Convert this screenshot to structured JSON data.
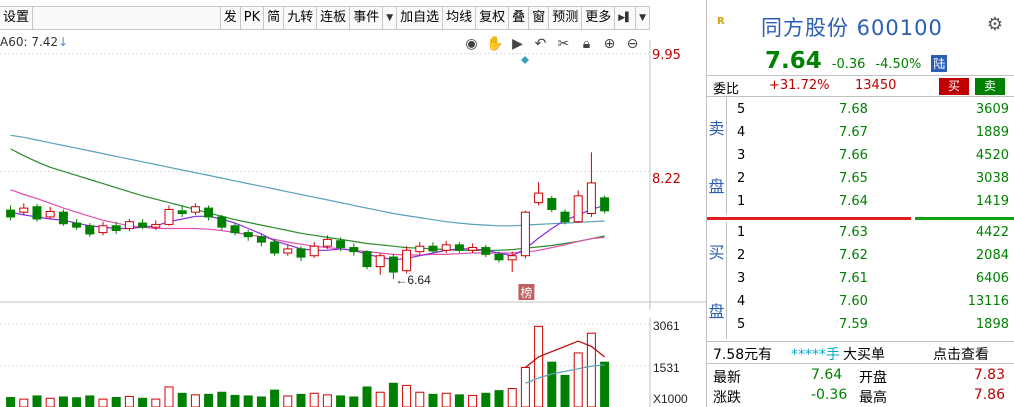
{
  "toolbar": {
    "settings": "设置",
    "items": [
      "发",
      "PK",
      "简",
      "九转",
      "连板",
      "事件",
      "加自选",
      "均线",
      "复权",
      "叠",
      "窗",
      "预测",
      "更多"
    ]
  },
  "ma_label": {
    "text": "A60: 7.42",
    "arrow": "↓"
  },
  "price_axis": {
    "high": "9.95",
    "mid": "8.22",
    "low_marker": "6.64"
  },
  "volume_axis": {
    "v1": "3061",
    "v2": "1531",
    "unit": "X1000"
  },
  "marker_tag": "榜",
  "stock": {
    "badge": "R",
    "title": "同方股份 600100",
    "price": "7.64",
    "change": "-0.36",
    "change_pct": "-4.50%",
    "board": "陆"
  },
  "weibi": {
    "label": "委比",
    "pct": "+31.72%",
    "diff": "13450",
    "buy": "买",
    "sell": "卖"
  },
  "sell_book": {
    "side_chars": [
      "卖",
      "盘"
    ],
    "rows": [
      {
        "level": "5",
        "price": "7.68",
        "volume": "3609"
      },
      {
        "level": "4",
        "price": "7.67",
        "volume": "1889"
      },
      {
        "level": "3",
        "price": "7.66",
        "volume": "4520"
      },
      {
        "level": "2",
        "price": "7.65",
        "volume": "3038"
      },
      {
        "level": "1",
        "price": "7.64",
        "volume": "1419"
      }
    ]
  },
  "buy_book": {
    "side_chars": [
      "买",
      "盘"
    ],
    "rows": [
      {
        "level": "1",
        "price": "7.63",
        "volume": "4422"
      },
      {
        "level": "2",
        "price": "7.62",
        "volume": "2084"
      },
      {
        "level": "3",
        "price": "7.61",
        "volume": "6406"
      },
      {
        "level": "4",
        "price": "7.60",
        "volume": "13116"
      },
      {
        "level": "5",
        "price": "7.59",
        "volume": "1898"
      }
    ]
  },
  "big_order": {
    "p1": "7.58元有",
    "p2": "*****手",
    "p3": "大买单",
    "p4": "点击查看"
  },
  "stats": [
    {
      "k1": "最新",
      "v1": "7.64",
      "k2": "开盘",
      "v2": "7.83"
    },
    {
      "k1": "涨跌",
      "v1": "-0.36",
      "k2": "最高",
      "v2": "7.86"
    }
  ],
  "colors": {
    "up": "#c00000",
    "down": "#008000",
    "accent": "#2b5fb3"
  },
  "chart_data": {
    "type": "candlestick",
    "price_ylim": [
      6.3,
      10.15
    ],
    "candles": [
      {
        "o": 7.65,
        "c": 7.55,
        "h": 7.72,
        "l": 7.5
      },
      {
        "o": 7.62,
        "c": 7.68,
        "h": 7.75,
        "l": 7.58
      },
      {
        "o": 7.7,
        "c": 7.52,
        "h": 7.74,
        "l": 7.48
      },
      {
        "o": 7.55,
        "c": 7.63,
        "h": 7.7,
        "l": 7.52
      },
      {
        "o": 7.62,
        "c": 7.45,
        "h": 7.66,
        "l": 7.42
      },
      {
        "o": 7.46,
        "c": 7.4,
        "h": 7.52,
        "l": 7.36
      },
      {
        "o": 7.42,
        "c": 7.3,
        "h": 7.46,
        "l": 7.26
      },
      {
        "o": 7.32,
        "c": 7.42,
        "h": 7.48,
        "l": 7.28
      },
      {
        "o": 7.42,
        "c": 7.35,
        "h": 7.48,
        "l": 7.3
      },
      {
        "o": 7.38,
        "c": 7.48,
        "h": 7.52,
        "l": 7.34
      },
      {
        "o": 7.46,
        "c": 7.4,
        "h": 7.52,
        "l": 7.37
      },
      {
        "o": 7.4,
        "c": 7.44,
        "h": 7.5,
        "l": 7.36
      },
      {
        "o": 7.44,
        "c": 7.66,
        "h": 7.72,
        "l": 7.42
      },
      {
        "o": 7.64,
        "c": 7.6,
        "h": 7.72,
        "l": 7.55
      },
      {
        "o": 7.62,
        "c": 7.7,
        "h": 7.75,
        "l": 7.58
      },
      {
        "o": 7.68,
        "c": 7.55,
        "h": 7.72,
        "l": 7.5
      },
      {
        "o": 7.55,
        "c": 7.4,
        "h": 7.58,
        "l": 7.36
      },
      {
        "o": 7.42,
        "c": 7.32,
        "h": 7.46,
        "l": 7.28
      },
      {
        "o": 7.32,
        "c": 7.26,
        "h": 7.36,
        "l": 7.2
      },
      {
        "o": 7.26,
        "c": 7.18,
        "h": 7.3,
        "l": 7.12
      },
      {
        "o": 7.18,
        "c": 7.02,
        "h": 7.22,
        "l": 6.98
      },
      {
        "o": 7.02,
        "c": 7.08,
        "h": 7.14,
        "l": 6.98
      },
      {
        "o": 7.08,
        "c": 6.96,
        "h": 7.12,
        "l": 6.9
      },
      {
        "o": 6.98,
        "c": 7.12,
        "h": 7.18,
        "l": 6.95
      },
      {
        "o": 7.12,
        "c": 7.22,
        "h": 7.28,
        "l": 7.08
      },
      {
        "o": 7.2,
        "c": 7.1,
        "h": 7.25,
        "l": 7.05
      },
      {
        "o": 7.1,
        "c": 7.04,
        "h": 7.16,
        "l": 6.98
      },
      {
        "o": 7.04,
        "c": 6.82,
        "h": 7.06,
        "l": 6.78
      },
      {
        "o": 6.82,
        "c": 6.98,
        "h": 7.02,
        "l": 6.7
      },
      {
        "o": 6.96,
        "c": 6.74,
        "h": 7.0,
        "l": 6.64
      },
      {
        "o": 6.76,
        "c": 7.06,
        "h": 7.12,
        "l": 6.72
      },
      {
        "o": 7.04,
        "c": 7.12,
        "h": 7.18,
        "l": 7.0
      },
      {
        "o": 7.12,
        "c": 7.05,
        "h": 7.18,
        "l": 7.02
      },
      {
        "o": 7.06,
        "c": 7.14,
        "h": 7.2,
        "l": 7.02
      },
      {
        "o": 7.14,
        "c": 7.06,
        "h": 7.18,
        "l": 7.02
      },
      {
        "o": 7.06,
        "c": 7.1,
        "h": 7.16,
        "l": 7.02
      },
      {
        "o": 7.1,
        "c": 7.0,
        "h": 7.14,
        "l": 6.96
      },
      {
        "o": 7.0,
        "c": 6.92,
        "h": 7.04,
        "l": 6.88
      },
      {
        "o": 6.92,
        "c": 6.98,
        "h": 7.04,
        "l": 6.74
      },
      {
        "o": 6.98,
        "c": 7.62,
        "h": 7.64,
        "l": 6.94
      },
      {
        "o": 7.76,
        "c": 7.9,
        "h": 8.06,
        "l": 7.72
      },
      {
        "o": 7.82,
        "c": 7.66,
        "h": 7.86,
        "l": 7.62
      },
      {
        "o": 7.62,
        "c": 7.48,
        "h": 7.66,
        "l": 7.44
      },
      {
        "o": 7.48,
        "c": 7.86,
        "h": 7.94,
        "l": 7.46
      },
      {
        "o": 7.6,
        "c": 8.05,
        "h": 8.5,
        "l": 7.55
      },
      {
        "o": 7.83,
        "c": 7.64,
        "h": 7.86,
        "l": 7.6
      }
    ],
    "volumes": [
      {
        "v": 360,
        "up": false
      },
      {
        "v": 300,
        "up": true
      },
      {
        "v": 420,
        "up": false
      },
      {
        "v": 330,
        "up": true
      },
      {
        "v": 380,
        "up": false
      },
      {
        "v": 350,
        "up": false
      },
      {
        "v": 420,
        "up": false
      },
      {
        "v": 300,
        "up": true
      },
      {
        "v": 360,
        "up": false
      },
      {
        "v": 400,
        "up": true
      },
      {
        "v": 330,
        "up": false
      },
      {
        "v": 300,
        "up": true
      },
      {
        "v": 760,
        "up": true
      },
      {
        "v": 520,
        "up": false
      },
      {
        "v": 460,
        "up": true
      },
      {
        "v": 480,
        "up": false
      },
      {
        "v": 560,
        "up": false
      },
      {
        "v": 440,
        "up": false
      },
      {
        "v": 420,
        "up": false
      },
      {
        "v": 380,
        "up": false
      },
      {
        "v": 640,
        "up": false
      },
      {
        "v": 420,
        "up": true
      },
      {
        "v": 480,
        "up": false
      },
      {
        "v": 520,
        "up": true
      },
      {
        "v": 460,
        "up": true
      },
      {
        "v": 420,
        "up": false
      },
      {
        "v": 380,
        "up": false
      },
      {
        "v": 760,
        "up": false
      },
      {
        "v": 560,
        "up": true
      },
      {
        "v": 900,
        "up": false
      },
      {
        "v": 820,
        "up": true
      },
      {
        "v": 560,
        "up": true
      },
      {
        "v": 480,
        "up": false
      },
      {
        "v": 520,
        "up": true
      },
      {
        "v": 460,
        "up": false
      },
      {
        "v": 440,
        "up": true
      },
      {
        "v": 520,
        "up": false
      },
      {
        "v": 620,
        "up": false
      },
      {
        "v": 700,
        "up": true
      },
      {
        "v": 1500,
        "up": true
      },
      {
        "v": 3061,
        "up": true
      },
      {
        "v": 1700,
        "up": false
      },
      {
        "v": 1200,
        "up": false
      },
      {
        "v": 2050,
        "up": true
      },
      {
        "v": 2800,
        "up": true
      },
      {
        "v": 1700,
        "up": false
      }
    ],
    "volume_ylim": [
      0,
      3300
    ],
    "ma_lines": [
      {
        "color": "#2a8a2a",
        "values": [
          8.55,
          8.45,
          8.36,
          8.28,
          8.22,
          8.16,
          8.1,
          8.04,
          7.98,
          7.92,
          7.86,
          7.81,
          7.76,
          7.71,
          7.66,
          7.61,
          7.56,
          7.51,
          7.47,
          7.43,
          7.39,
          7.35,
          7.31,
          7.28,
          7.25,
          7.22,
          7.19,
          7.16,
          7.14,
          7.12,
          7.1,
          7.09,
          7.08,
          7.07,
          7.06,
          7.06,
          7.06,
          7.06,
          7.07,
          7.09,
          7.11,
          7.13,
          7.16,
          7.19,
          7.23,
          7.27
        ]
      },
      {
        "color": "#5aa0b8",
        "values": [
          8.75,
          8.72,
          8.68,
          8.64,
          8.6,
          8.56,
          8.52,
          8.48,
          8.44,
          8.4,
          8.36,
          8.32,
          8.28,
          8.24,
          8.2,
          8.16,
          8.12,
          8.08,
          8.04,
          8.0,
          7.96,
          7.92,
          7.88,
          7.84,
          7.8,
          7.76,
          7.72,
          7.68,
          7.64,
          7.6,
          7.57,
          7.54,
          7.51,
          7.48,
          7.46,
          7.44,
          7.43,
          7.42,
          7.42,
          7.43,
          7.44,
          7.45,
          7.46,
          7.47,
          7.48,
          7.49
        ]
      },
      {
        "color": "#e04fb0",
        "values": [
          7.95,
          7.88,
          7.82,
          7.75,
          7.68,
          7.62,
          7.56,
          7.5,
          7.46,
          7.42,
          7.4,
          7.38,
          7.38,
          7.38,
          7.38,
          7.37,
          7.35,
          7.32,
          7.29,
          7.26,
          7.22,
          7.18,
          7.15,
          7.12,
          7.1,
          7.08,
          7.06,
          7.04,
          7.02,
          7.0,
          6.99,
          6.99,
          7.0,
          7.0,
          7.01,
          7.02,
          7.02,
          7.02,
          7.02,
          7.03,
          7.06,
          7.1,
          7.14,
          7.19,
          7.23,
          7.25
        ]
      },
      {
        "color": "#8a2be2",
        "values": [
          7.62,
          7.58,
          7.55,
          7.52,
          7.5,
          7.46,
          7.42,
          7.4,
          7.38,
          7.38,
          7.4,
          7.42,
          7.48,
          7.52,
          7.56,
          7.56,
          7.52,
          7.46,
          7.38,
          7.3,
          7.2,
          7.14,
          7.08,
          7.06,
          7.06,
          7.08,
          7.06,
          7.0,
          6.96,
          6.92,
          6.94,
          6.98,
          7.02,
          7.06,
          7.08,
          7.08,
          7.06,
          7.02,
          6.98,
          7.08,
          7.24,
          7.38,
          7.5,
          7.58,
          7.66,
          7.72
        ]
      }
    ],
    "volume_ma_lines": [
      {
        "color": "#c00000",
        "points": [
          [
            39,
            1500
          ],
          [
            40,
            1900
          ],
          [
            41,
            2100
          ],
          [
            42,
            2300
          ],
          [
            43,
            2500
          ],
          [
            44,
            2300
          ],
          [
            45,
            1900
          ]
        ]
      },
      {
        "color": "#5aa0b8",
        "points": [
          [
            39,
            900
          ],
          [
            40,
            1100
          ],
          [
            41,
            1250
          ],
          [
            42,
            1350
          ],
          [
            43,
            1450
          ],
          [
            44,
            1550
          ],
          [
            45,
            1600
          ]
        ]
      }
    ]
  }
}
